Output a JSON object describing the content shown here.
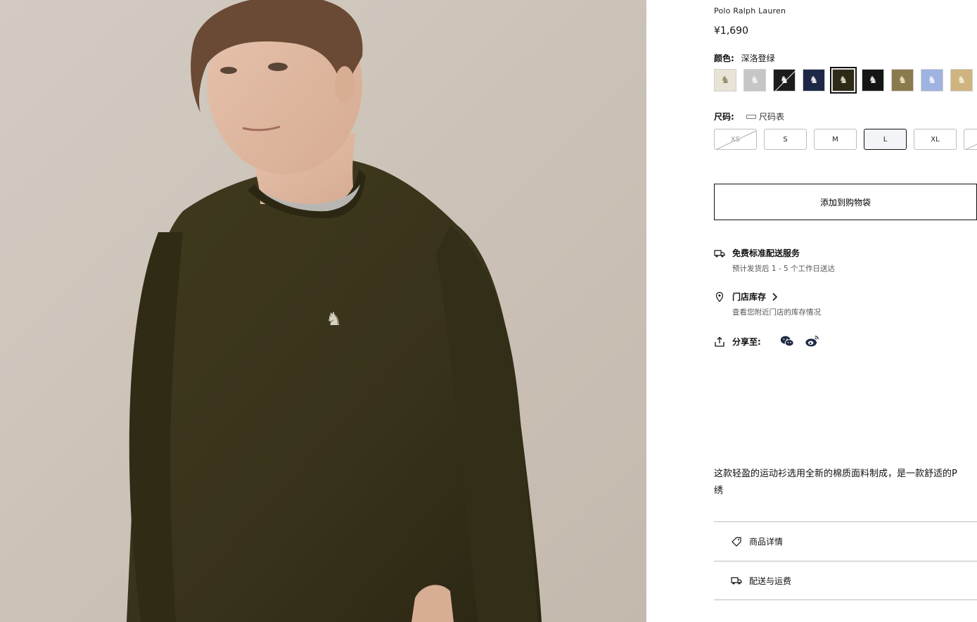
{
  "product": {
    "brand": "Polo Ralph Lauren",
    "price": "¥1,690"
  },
  "color": {
    "label": "颜色:",
    "selected_name": "深洛登绿",
    "swatches": [
      {
        "name": "cream",
        "bg": "#e8e3d6",
        "pony": "#9a8a6a"
      },
      {
        "name": "grey",
        "bg": "#c6c6c6",
        "pony": "#efefef"
      },
      {
        "name": "black-unavailable",
        "bg": "#1b1b1b",
        "pony": "#f0f0f0"
      },
      {
        "name": "navy",
        "bg": "#1d2846",
        "pony": "#e8e8e8"
      },
      {
        "name": "loden-selected",
        "bg": "#2e2a18",
        "pony": "#d9d2bd"
      },
      {
        "name": "black",
        "bg": "#151515",
        "pony": "#e6e6e6"
      },
      {
        "name": "olive-brown",
        "bg": "#8a7a4e",
        "pony": "#e8dcc0"
      },
      {
        "name": "light-blue",
        "bg": "#9fb3e0",
        "pony": "#eef2fb"
      },
      {
        "name": "tan",
        "bg": "#cfb47f",
        "pony": "#f4ead4"
      }
    ]
  },
  "size": {
    "label": "尺码:",
    "chart_link": "尺码表",
    "options": [
      "XS",
      "S",
      "M",
      "L",
      "XL"
    ],
    "selected": "L"
  },
  "add_to_bag": "添加到购物袋",
  "shipping": {
    "title": "免费标准配送服务",
    "subtitle": "预计发货后 1 - 5 个工作日送达"
  },
  "store_stock": {
    "title": "门店库存",
    "subtitle": "查看您附近门店的库存情况"
  },
  "share": {
    "label": "分享至:"
  },
  "description": {
    "line1": "这款轻盈的运动衫选用全新的棉质面料制成，是一款舒适的P",
    "line2": "绣"
  },
  "accordion": {
    "details": "商品详情",
    "delivery": "配送与运费"
  }
}
